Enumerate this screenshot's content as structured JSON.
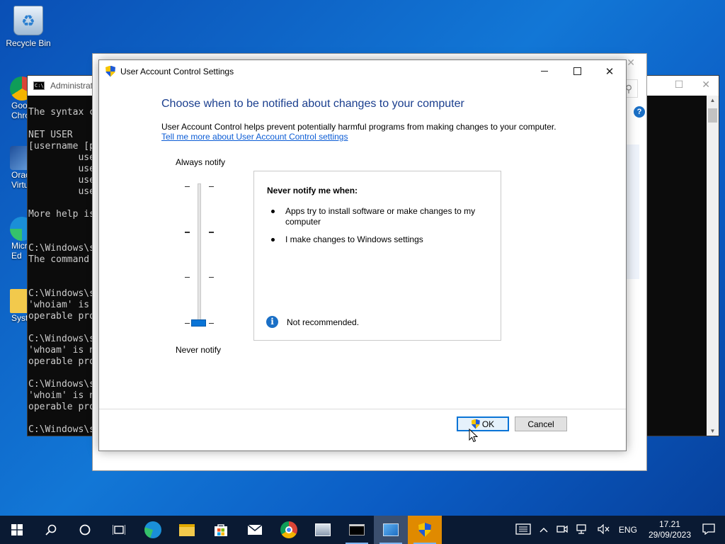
{
  "desktop": {
    "icons": [
      {
        "label": "Recycle Bin"
      },
      {
        "label": "Goo\nChro"
      },
      {
        "label": "Oracl\nVirtua"
      },
      {
        "label": "Micr\nEd"
      },
      {
        "label": "Syst"
      }
    ]
  },
  "console": {
    "title": "Administrat",
    "lines": "The syntax c\n\nNET USER\n[username [p\n         use\n         use\n         use\n         use\n\nMore help is\n\n\nC:\\Windows\\s\nThe command \n\n\nC:\\Windows\\s\n'whoiam' is \noperable pro\n\nC:\\Windows\\s\n'whoam' is n\noperable pro\n\nC:\\Windows\\s\n'whoim' is n\noperable pro\n\nC:\\Windows\\s"
  },
  "uac": {
    "title": "User Account Control Settings",
    "heading": "Choose when to be notified about changes to your computer",
    "description": "User Account Control helps prevent potentially harmful programs from making changes to your computer.",
    "link": "Tell me more about User Account Control settings",
    "slider": {
      "top_label": "Always notify",
      "bottom_label": "Never notify",
      "level": 0,
      "levels": 4
    },
    "info": {
      "title": "Never notify me when:",
      "items": [
        "Apps try to install software or make changes to my computer",
        "I make changes to Windows settings"
      ],
      "note": "Not recommended."
    },
    "ok_label": "OK",
    "cancel_label": "Cancel"
  },
  "taskbar": {
    "language": "ENG",
    "time": "17.21",
    "date": "29/09/2023"
  },
  "colors": {
    "accent": "#0a74d6",
    "heading": "#1a3e8e",
    "link": "#0b5cd5",
    "taskbar": "#0a1a33"
  }
}
